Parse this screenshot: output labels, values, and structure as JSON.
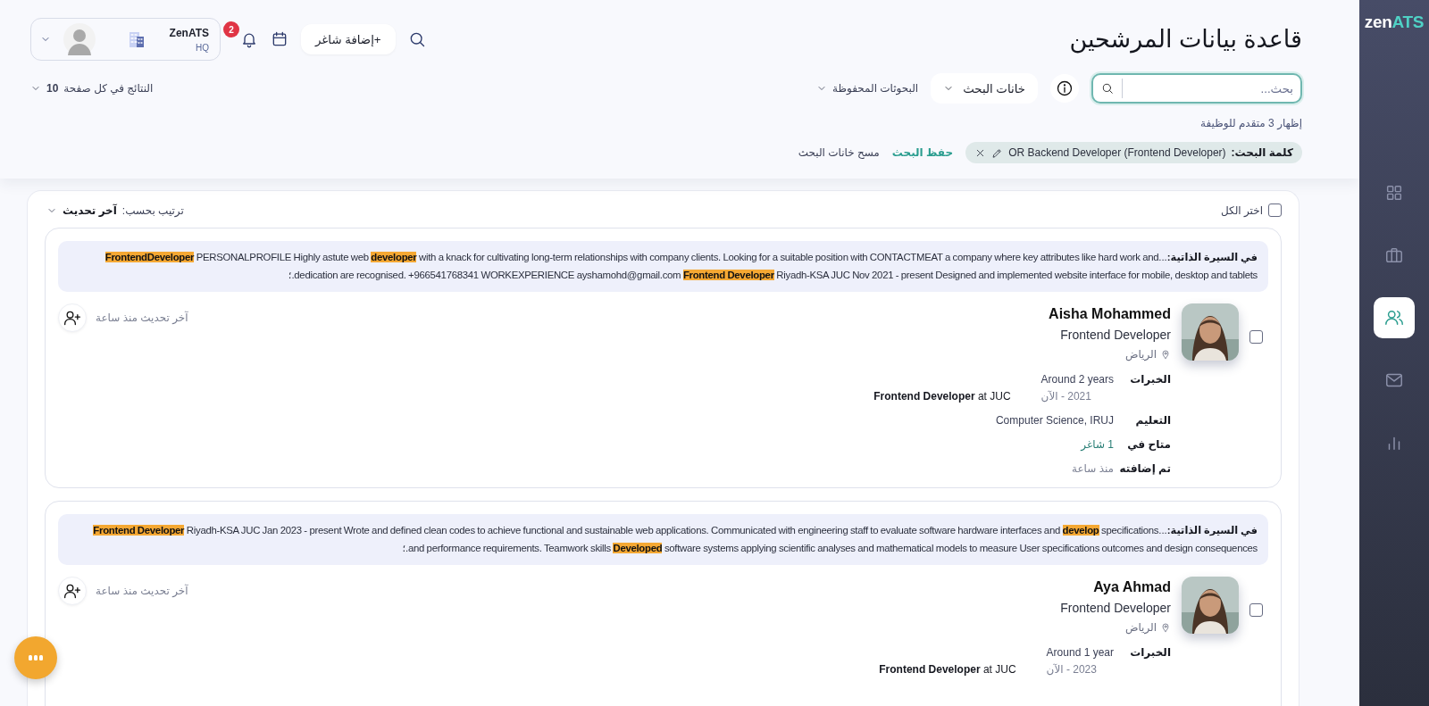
{
  "sidebar": {
    "logo": {
      "main": "zen",
      "accent": "ATS"
    },
    "items": [
      {
        "kind": "grid",
        "selected": false
      },
      {
        "kind": "briefcase",
        "selected": false
      },
      {
        "kind": "users",
        "selected": true
      },
      {
        "kind": "mail",
        "selected": false
      },
      {
        "kind": "chart",
        "selected": false
      }
    ]
  },
  "header": {
    "title": "قاعدة بيانات المرشحين",
    "add_button": "+إضافة شاغر",
    "notification_count": "2",
    "account": {
      "name": "ZenATS",
      "branch": "HQ"
    }
  },
  "search": {
    "placeholder": "بحث...",
    "fields_button": "خانات البحث",
    "saved_searches": "البحوثات المحفوظة",
    "per_page": {
      "label": "النتائج في كل صفحة",
      "value": "10"
    },
    "result_count": "إظهار 3 متقدم للوظيفة",
    "keyword_chip": {
      "label": "كلمة البحث:",
      "value": "OR Backend Developer (Frontend Developer)"
    },
    "save_link": "حفظ البحث",
    "clear_link": "مسح خانات البحث"
  },
  "list": {
    "select_all": {
      "label": "اختر الكل",
      "checked": false
    },
    "sort": {
      "label": "ترتيب بحسب:",
      "value": "آخر تحديث"
    }
  },
  "candidates": [
    {
      "checked": false,
      "snippet_label": "في السيرة الذاتية:",
      "snippet_lines": [
        "...**FrontendDeveloper** PERSONALPROFILE Highly astute web **developer** with a knack for cultivating long-term relationships with company clients. Looking for a suitable position with CONTACTMEAT a company where key attributes like hard work and",
        "dedication are recognised. +966541768341 WORKEXPERIENCE ayshamohd@gmail.com **Frontend Developer** Riyadh-KSA JUC Nov 2021 - present Designed and implemented website interface for mobile, desktop and tablets"
      ],
      "snippet_end": ".؛",
      "name": "Aisha Mohammed",
      "title": "Frontend Developer",
      "location": "الرياض",
      "updated": "آخر تحديث منذ ساعة",
      "details": [
        {
          "kind": "experience",
          "label": "الخبرات",
          "duration": "Around 2 years",
          "period": "2021 - الآن",
          "role": "**Frontend Developer** at JUC"
        },
        {
          "kind": "text",
          "label": "التعليم",
          "value": "Computer Science, IRUJ"
        },
        {
          "kind": "link",
          "label": "متاح في",
          "value": "1 شاغر"
        },
        {
          "kind": "muted",
          "label": "تم إضافته",
          "value": "منذ ساعة"
        }
      ]
    },
    {
      "checked": false,
      "snippet_label": "في السيرة الذاتية:",
      "snippet_lines": [
        "...**Frontend Developer** Riyadh-KSA JUC Jan 2023 - present Wrote and defined clean codes to achieve functional and sustainable web applications. Communicated with engineering staff to evaluate software hardware interfaces and **develop** specifications",
        "and performance requirements. Teamwork skills **Developed** software systems applying scientific analyses and mathematical models to measure User specifications outcomes and design consequences"
      ],
      "snippet_end": ".؛",
      "name": "Aya Ahmad",
      "title": "Frontend Developer",
      "location": "الرياض",
      "updated": "آخر تحديث منذ ساعة",
      "details": [
        {
          "kind": "experience",
          "label": "الخبرات",
          "duration": "Around 1 year",
          "period": "2023 - الآن",
          "role": "**Frontend Developer** at JUC"
        }
      ]
    }
  ]
}
